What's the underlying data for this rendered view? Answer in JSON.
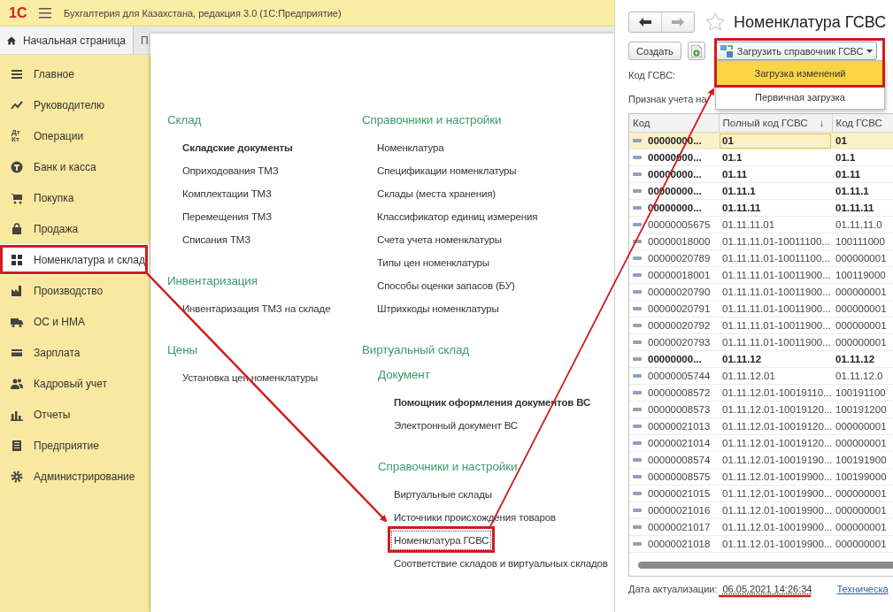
{
  "app": {
    "logo": "1С",
    "title": "Бухгалтерия для Казахстана, редакция 3.0  (1С:Предприятие)"
  },
  "tabs": [
    {
      "label": "Начальная страница",
      "selected": true
    },
    {
      "label": "П",
      "selected": false
    }
  ],
  "sidebar": {
    "items": [
      {
        "label": "Главное",
        "selected": false
      },
      {
        "label": "Руководителю",
        "selected": false
      },
      {
        "label": "Операции",
        "selected": false,
        "icon_text": "Дт Кт"
      },
      {
        "label": "Банк и касса",
        "selected": false
      },
      {
        "label": "Покупка",
        "selected": false
      },
      {
        "label": "Продажа",
        "selected": false
      },
      {
        "label": "Номенклатура и склад",
        "selected": true
      },
      {
        "label": "Производство",
        "selected": false
      },
      {
        "label": "ОС и НМА",
        "selected": false
      },
      {
        "label": "Зарплата",
        "selected": false
      },
      {
        "label": "Кадровый учет",
        "selected": false
      },
      {
        "label": "Отчеты",
        "selected": false
      },
      {
        "label": "Предприятие",
        "selected": false
      },
      {
        "label": "Администрирование",
        "selected": false
      }
    ]
  },
  "sections": {
    "columns": [
      {
        "groups": [
          {
            "title": "Склад",
            "items": [
              {
                "label": "Складские документы",
                "important": true,
                "focused": false
              },
              {
                "label": "Оприходования ТМЗ",
                "important": false,
                "focused": false
              },
              {
                "label": "Комплектации ТМЗ",
                "important": false,
                "focused": false
              },
              {
                "label": "Перемещения ТМЗ",
                "important": false,
                "focused": false
              },
              {
                "label": "Списания ТМЗ",
                "important": false,
                "focused": false
              }
            ]
          },
          {
            "title": "Инвентаризация",
            "items": [
              {
                "label": "Инвентаризация ТМЗ на складе",
                "important": false,
                "focused": false
              }
            ]
          },
          {
            "title": "Цены",
            "items": [
              {
                "label": "Установка цен номенклатуры",
                "important": false,
                "focused": false
              }
            ]
          }
        ]
      },
      {
        "groups": [
          {
            "title": "Справочники и настройки",
            "items": [
              {
                "label": "Номенклатура",
                "important": false,
                "focused": false
              },
              {
                "label": "Спецификации номенклатуры",
                "important": false,
                "focused": false
              },
              {
                "label": "Склады (места хранения)",
                "important": false,
                "focused": false
              },
              {
                "label": "Классификатор единиц измерения",
                "important": false,
                "focused": false
              },
              {
                "label": "Счета учета номенклатуры",
                "important": false,
                "focused": false
              },
              {
                "label": "Типы цен номенклатуры",
                "important": false,
                "focused": false
              },
              {
                "label": "Способы оценки запасов (БУ)",
                "important": false,
                "focused": false
              },
              {
                "label": "Штрихкоды номенклатуры",
                "important": false,
                "focused": false
              }
            ]
          },
          {
            "title": "Виртуальный склад",
            "children": [
              {
                "title": "Документ",
                "items": [
                  {
                    "label": "Помощник оформления документов ВС",
                    "important": true,
                    "focused": false
                  },
                  {
                    "label": "Электронный документ ВС",
                    "important": false,
                    "focused": false
                  }
                ]
              },
              {
                "title": "Справочники и настройки",
                "items": [
                  {
                    "label": "Виртуальные склады",
                    "important": false,
                    "focused": false
                  },
                  {
                    "label": "Источники происхождения товаров",
                    "important": false,
                    "focused": false
                  },
                  {
                    "label": "Номенклатура ГСВС",
                    "important": false,
                    "focused": true
                  },
                  {
                    "label": "Соответствие складов и виртуальных складов",
                    "important": false,
                    "focused": false
                  }
                ]
              }
            ]
          }
        ]
      }
    ]
  },
  "catalog": {
    "title": "Номенклатура ГСВС",
    "create_button": "Создать",
    "load_button": "Загрузить справочник ГСВС",
    "load_menu": [
      {
        "label": "Загрузка изменений",
        "selected": true
      },
      {
        "label": "Первичная загрузка",
        "selected": false
      }
    ],
    "fields": [
      "Код ГСВС:",
      "Признак учета на"
    ],
    "table": {
      "columns": [
        {
          "label": "Код"
        },
        {
          "label": "Полный код ГСВС",
          "sort": "↓"
        },
        {
          "label": "Код ГСВС"
        }
      ],
      "rows": [
        {
          "cells": [
            "00000000...",
            "01",
            "01"
          ],
          "group": true,
          "selected": true
        },
        {
          "cells": [
            "00000000...",
            "01.1",
            "01.1"
          ],
          "group": true,
          "selected": false
        },
        {
          "cells": [
            "00000000...",
            "01.11",
            "01.11"
          ],
          "group": true,
          "selected": false
        },
        {
          "cells": [
            "00000000...",
            "01.11.1",
            "01.11.1"
          ],
          "group": true,
          "selected": false
        },
        {
          "cells": [
            "00000000...",
            "01.11.11",
            "01.11.11"
          ],
          "group": true,
          "selected": false
        },
        {
          "cells": [
            "00000005675",
            "01.11.11.01",
            "01.11.11.0"
          ],
          "group": false,
          "selected": false
        },
        {
          "cells": [
            "00000018000",
            "01.11.11.01-10011100...",
            "100111000"
          ],
          "group": false,
          "selected": false
        },
        {
          "cells": [
            "00000020789",
            "01.11.11.01-10011100...",
            "000000001"
          ],
          "group": false,
          "selected": false
        },
        {
          "cells": [
            "00000018001",
            "01.11.11.01-10011900...",
            "100119000"
          ],
          "group": false,
          "selected": false
        },
        {
          "cells": [
            "00000020790",
            "01.11.11.01-10011900...",
            "000000001"
          ],
          "group": false,
          "selected": false
        },
        {
          "cells": [
            "00000020791",
            "01.11.11.01-10011900...",
            "000000001"
          ],
          "group": false,
          "selected": false
        },
        {
          "cells": [
            "00000020792",
            "01.11.11.01-10011900...",
            "000000001"
          ],
          "group": false,
          "selected": false
        },
        {
          "cells": [
            "00000020793",
            "01.11.11.01-10011900...",
            "000000001"
          ],
          "group": false,
          "selected": false
        },
        {
          "cells": [
            "00000000...",
            "01.11.12",
            "01.11.12"
          ],
          "group": true,
          "selected": false
        },
        {
          "cells": [
            "00000005744",
            "01.11.12.01",
            "01.11.12.0"
          ],
          "group": false,
          "selected": false
        },
        {
          "cells": [
            "00000008572",
            "01.11.12.01-10019110...",
            "100191100"
          ],
          "group": false,
          "selected": false
        },
        {
          "cells": [
            "00000008573",
            "01.11.12.01-10019120...",
            "100191200"
          ],
          "group": false,
          "selected": false
        },
        {
          "cells": [
            "00000021013",
            "01.11.12.01-10019120...",
            "000000001"
          ],
          "group": false,
          "selected": false
        },
        {
          "cells": [
            "00000021014",
            "01.11.12.01-10019120...",
            "000000001"
          ],
          "group": false,
          "selected": false
        },
        {
          "cells": [
            "00000008574",
            "01.11.12.01-10019190...",
            "100191900"
          ],
          "group": false,
          "selected": false
        },
        {
          "cells": [
            "00000008575",
            "01.11.12.01-10019900...",
            "100199000"
          ],
          "group": false,
          "selected": false
        },
        {
          "cells": [
            "00000021015",
            "01.11.12.01-10019900...",
            "000000001"
          ],
          "group": false,
          "selected": false
        },
        {
          "cells": [
            "00000021016",
            "01.11.12.01-10019900...",
            "000000001"
          ],
          "group": false,
          "selected": false
        },
        {
          "cells": [
            "00000021017",
            "01.11.12.01-10019900...",
            "000000001"
          ],
          "group": false,
          "selected": false
        },
        {
          "cells": [
            "00000021018",
            "01.11.12.01-10019900...",
            "000000001"
          ],
          "group": false,
          "selected": false
        }
      ]
    },
    "footer": {
      "label": "Дата актуализации:",
      "date": "06.05.2021 14:26:34",
      "link": "Техническа"
    }
  }
}
